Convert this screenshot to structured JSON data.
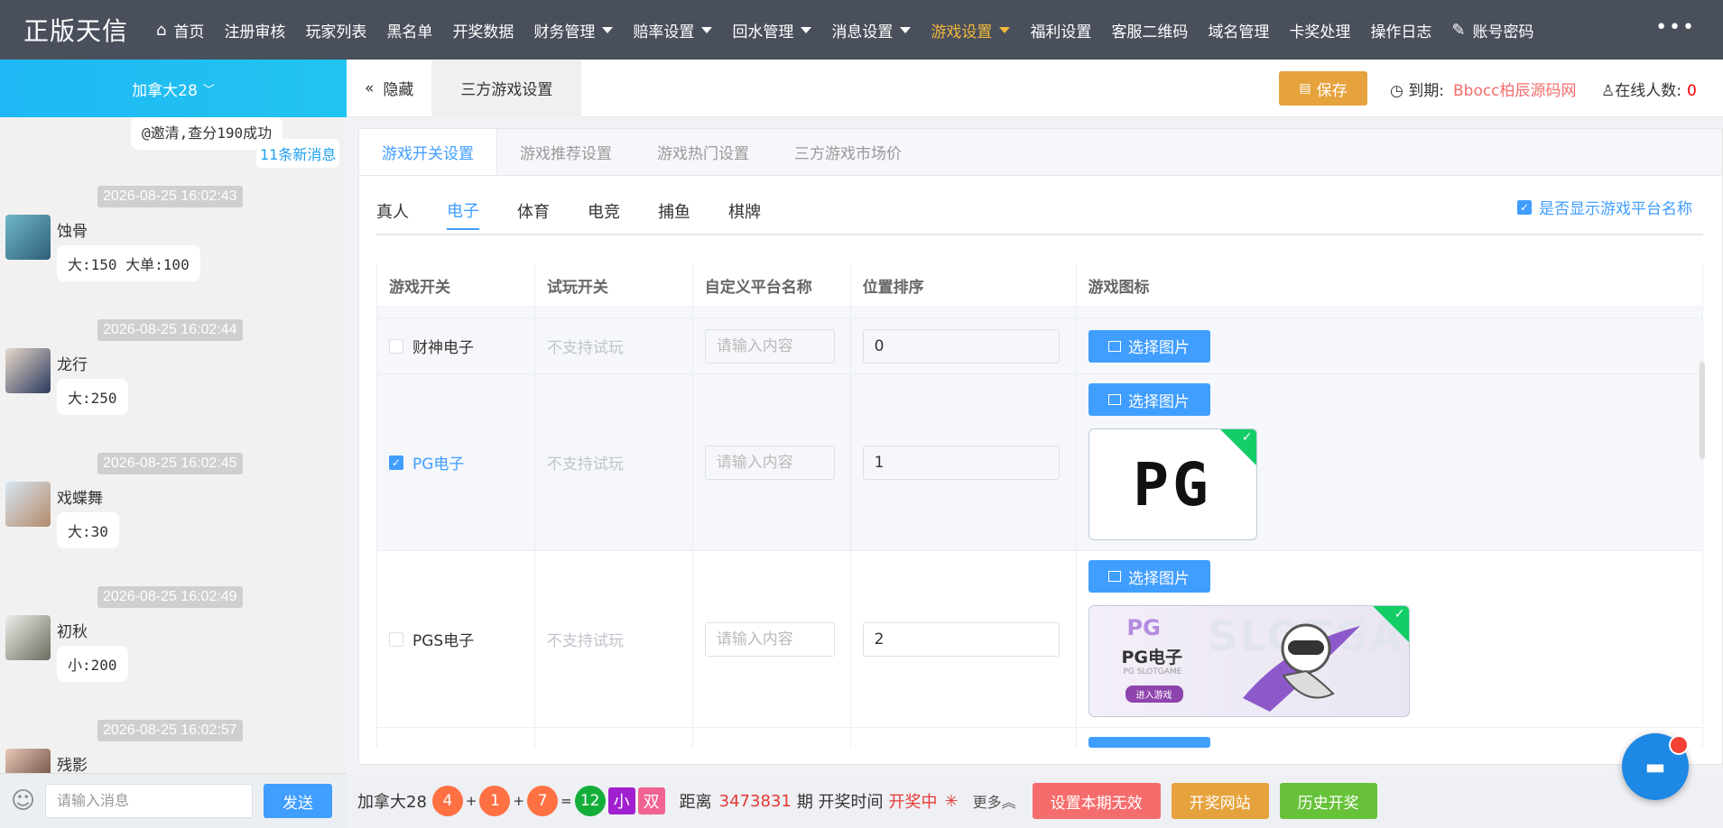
{
  "brand": "正版天信",
  "nav": [
    {
      "label": "首页",
      "icon": "home-icon"
    },
    {
      "label": "注册审核"
    },
    {
      "label": "玩家列表"
    },
    {
      "label": "黑名单"
    },
    {
      "label": "开奖数据"
    },
    {
      "label": "财务管理",
      "caret": true
    },
    {
      "label": "赔率设置",
      "caret": true
    },
    {
      "label": "回水管理",
      "caret": true
    },
    {
      "label": "消息设置",
      "caret": true
    },
    {
      "label": "游戏设置",
      "caret": true,
      "active": true
    },
    {
      "label": "福利设置"
    },
    {
      "label": "客服二维码"
    },
    {
      "label": "域名管理"
    },
    {
      "label": "卡奖处理"
    },
    {
      "label": "操作日志"
    },
    {
      "label": "账号密码",
      "icon": "edit-icon"
    }
  ],
  "more": "•••",
  "sidebar": {
    "room": "加拿大28",
    "top_message": "@邀清,查分190成功",
    "new_messages": "11条新消息",
    "messages": [
      {
        "time": "2026-08-25 16:02:43",
        "user": "蚀骨",
        "text": "大:150 大单:100"
      },
      {
        "time": "2026-08-25 16:02:44",
        "user": "龙行",
        "text": "大:250"
      },
      {
        "time": "2026-08-25 16:02:45",
        "user": "戏蝶舞",
        "text": "大:30"
      },
      {
        "time": "2026-08-25 16:02:49",
        "user": "初秋",
        "text": "小:200"
      },
      {
        "time": "2026-08-25 16:02:57",
        "user": "残影",
        "text": ""
      }
    ],
    "input_placeholder": "请输入消息",
    "send_label": "发送"
  },
  "subbar": {
    "hide_label": "隐藏",
    "tab_label": "三方游戏设置",
    "save_label": "保存",
    "expire_label": "到期:",
    "expire_value": "Bbocc柏辰源码网",
    "online_label": "在线人数:",
    "online_value": "0"
  },
  "panel": {
    "tabs": [
      "游戏开关设置",
      "游戏推荐设置",
      "游戏热门设置",
      "三方游戏市场价"
    ],
    "categories": [
      "真人",
      "电子",
      "体育",
      "电竞",
      "捕鱼",
      "棋牌"
    ],
    "active_category": 1,
    "show_platform_name": "是否显示游戏平台名称",
    "columns": [
      "游戏开关",
      "试玩开关",
      "自定义平台名称",
      "位置排序",
      "游戏图标"
    ],
    "rows": [
      {
        "name": "财神电子",
        "checked": false,
        "trial": "不支持试玩",
        "custom_placeholder": "请输入内容",
        "order": "0",
        "pick": "选择图片"
      },
      {
        "name": "PG电子",
        "checked": true,
        "trial": "不支持试玩",
        "custom_placeholder": "请输入内容",
        "order": "1",
        "pick": "选择图片",
        "thumb_text": "PG"
      },
      {
        "name": "PGS电子",
        "checked": false,
        "trial": "不支持试玩",
        "custom_placeholder": "请输入内容",
        "order": "2",
        "pick": "选择图片",
        "thumb_title": "PG",
        "thumb_sub": "PG电子",
        "thumb_small": "PG SLOTGAME",
        "thumb_btn": "进入游戏",
        "thumb_watermark": "SLOTGAME"
      }
    ]
  },
  "bottom": {
    "game": "加拿大28",
    "balls": [
      "4",
      "1",
      "7"
    ],
    "sum": "12",
    "size": "小",
    "parity": "双",
    "countdown_label": "距离",
    "period": "3473831",
    "period_label": "期 开奖时间",
    "status": "开奖中",
    "more_label": "更多",
    "btn_invalid": "设置本期无效",
    "btn_site": "开奖网站",
    "btn_history": "历史开奖"
  },
  "colors": {
    "accent": "#409eff",
    "nav_bg": "#4a4f5c",
    "active_nav": "#f1b83a",
    "save": "#e6a23c",
    "success": "#13ce66"
  }
}
